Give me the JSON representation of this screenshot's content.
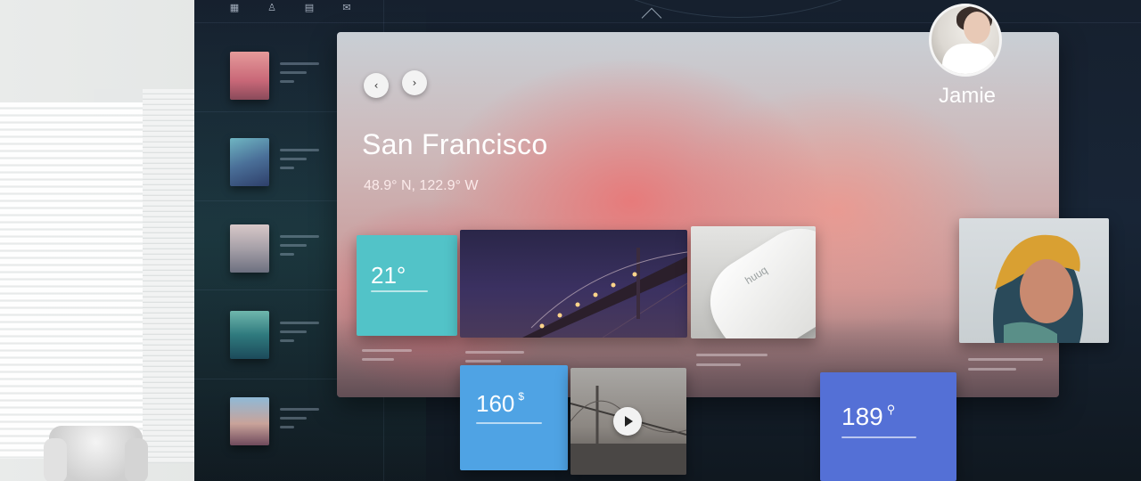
{
  "screen": {
    "top_icons": [
      {
        "icon": "grid-icon",
        "glyph": "▦"
      },
      {
        "icon": "profile-icon",
        "glyph": "♙"
      },
      {
        "icon": "document-icon",
        "glyph": "▤"
      },
      {
        "icon": "mail-icon",
        "glyph": "✉"
      }
    ],
    "list_items": [
      {
        "thumb": "pink-sky-photo"
      },
      {
        "thumb": "city-tower-photo"
      },
      {
        "thumb": "mountain-photo"
      },
      {
        "thumb": "forest-photo"
      },
      {
        "thumb": "sunset-photo"
      }
    ]
  },
  "hero": {
    "city": "San Francisco",
    "coords": "48.9° N, 122.9° W",
    "prev_glyph": "‹",
    "next_glyph": "›"
  },
  "tiles": {
    "temperature": {
      "value": "21°",
      "color": "#52c3c8"
    },
    "price": {
      "value": "160",
      "unit": "$",
      "color": "#4fa3e4"
    },
    "location": {
      "value": "189",
      "unit": "⚲",
      "color": "#5470d6"
    },
    "device_logo": "huuq"
  },
  "user": {
    "name": "Jamie"
  },
  "colors": {
    "hero_pink": "#e68080",
    "screen_dark": "#16202e"
  }
}
